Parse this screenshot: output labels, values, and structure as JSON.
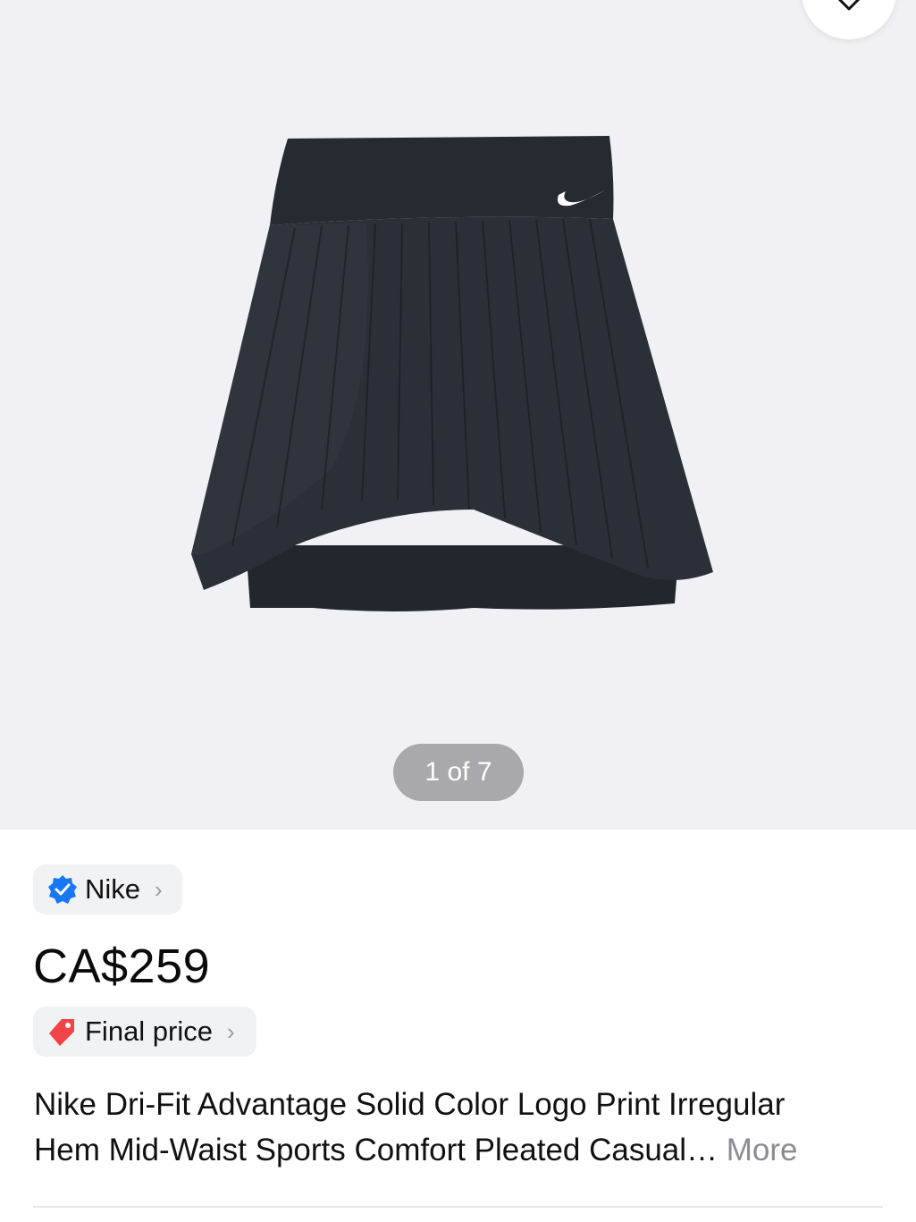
{
  "gallery": {
    "counter_text": "1 of 7",
    "image_alt": "Black pleated tennis skirt with white swoosh logo",
    "favorite_icon": "heart-icon"
  },
  "brand": {
    "name": "Nike",
    "verified_icon": "verified-badge-icon",
    "chevron_icon": "chevron-right-icon"
  },
  "price": {
    "value": "CA$259",
    "final_price_label": "Final price",
    "tag_icon": "price-tag-icon"
  },
  "product": {
    "title_line1": "Nike Dri-Fit Advantage Solid Color Logo Print Irregular",
    "title_line2": "Hem Mid-Waist Sports Comfort Pleated Casual…",
    "more_label": "More"
  },
  "colors": {
    "gallery_bg": "#f1f1f5",
    "verified_blue": "#1877f2",
    "tag_red": "#f0434a",
    "more_gray": "#8b8b93"
  }
}
